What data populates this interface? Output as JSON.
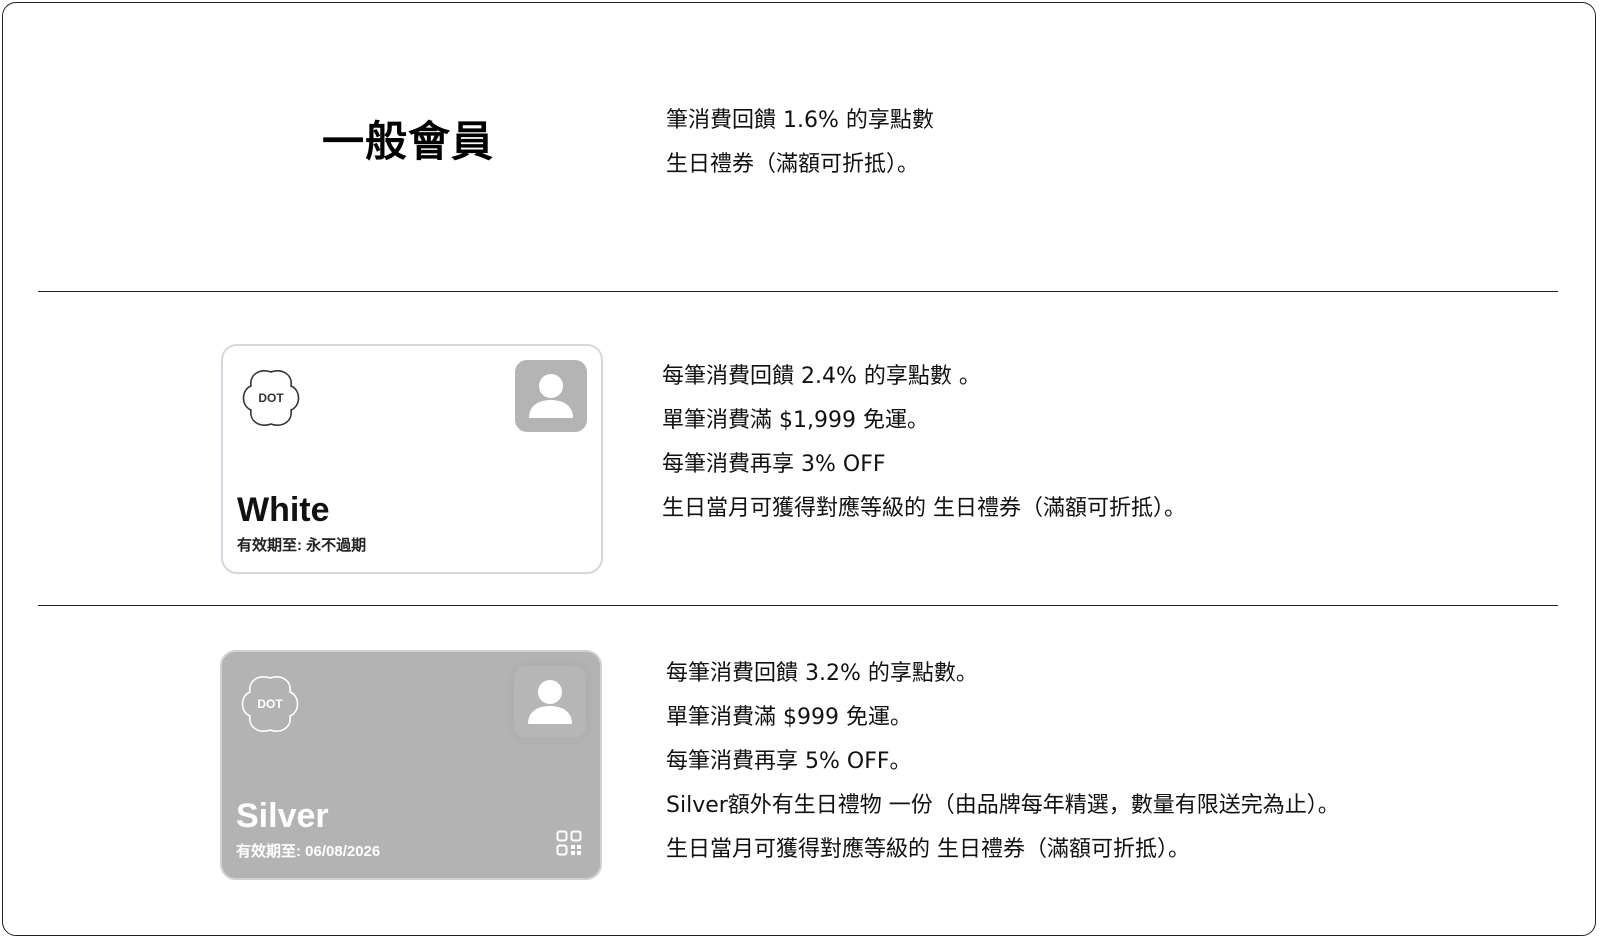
{
  "tiers": [
    {
      "title": "一般會員",
      "benefits": [
        "筆消費回饋 1.6% 的享點數",
        "生日禮券（滿額可折抵）。"
      ]
    },
    {
      "card": {
        "logo_text": "DOT",
        "tier_name": "White",
        "expiry": "有效期至: 永不過期"
      },
      "benefits": [
        "每筆消費回饋 2.4% 的享點數 。",
        "單筆消費滿 $1,999 免運。",
        "每筆消費再享 3% OFF",
        "生日當月可獲得對應等級的 生日禮券（滿額可折抵）。"
      ]
    },
    {
      "card": {
        "logo_text": "DOT",
        "tier_name": "Silver",
        "expiry": "有效期至: 06/08/2026"
      },
      "benefits": [
        "每筆消費回饋 3.2% 的享點數。",
        "單筆消費滿 $999 免運。",
        "每筆消費再享 5% OFF。",
        "Silver額外有生日禮物 一份（由品牌每年精選，數量有限送完為止）。",
        "生日當月可獲得對應等級的 生日禮券（滿額可折抵）。"
      ]
    }
  ],
  "colors": {
    "silver_card": "#b3b3b3",
    "avatar_gray": "#b4b4b4",
    "divider": "#222222"
  }
}
